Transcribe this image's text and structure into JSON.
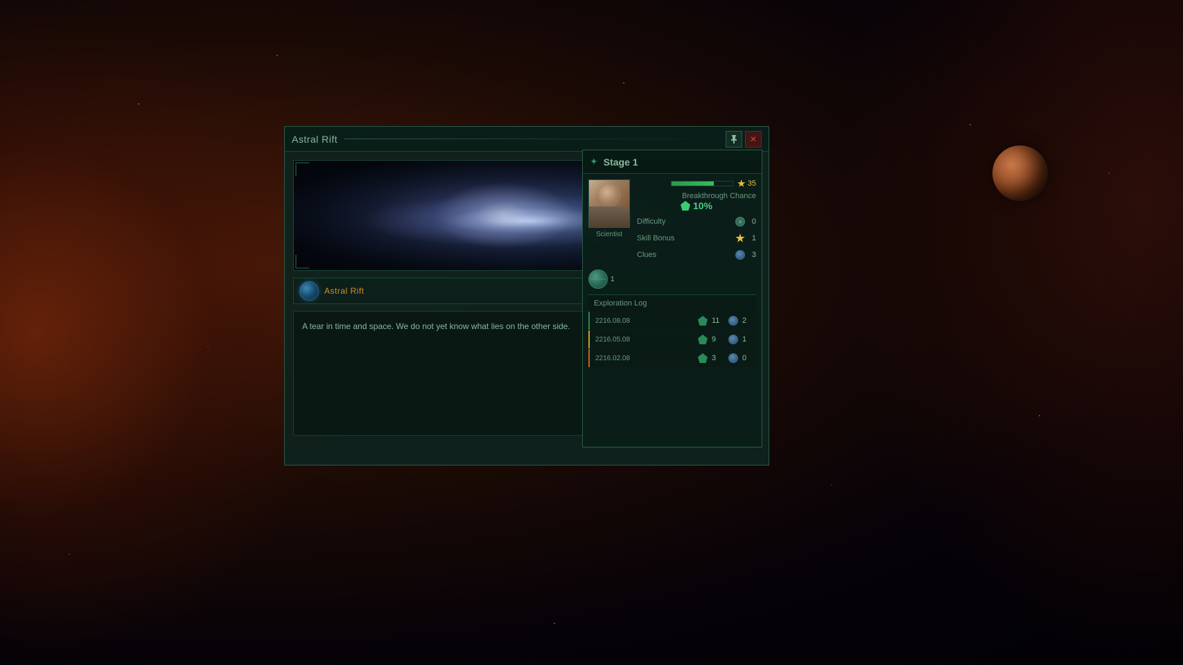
{
  "background": {
    "color": "#1a0a08"
  },
  "window": {
    "title": "Astral Rift",
    "subtitle": "Astral Rift",
    "description": "A tear in time and space. We do not yet know what lies on the other side.",
    "close_label": "✕",
    "pin_label": "⊕",
    "bar_title": "Astral Rift"
  },
  "stage": {
    "title": "Stage 1",
    "icon": "✦",
    "progress_value": "35",
    "breakthrough_label": "Breakthrough Chance",
    "breakthrough_value": "10%",
    "scientist_label": "Scientist",
    "stats": {
      "difficulty_label": "Difficulty",
      "difficulty_value": "0",
      "skill_label": "Skill Bonus",
      "skill_value": "1",
      "clues_label": "Clues",
      "clues_value": "3"
    },
    "globe_number": "1"
  },
  "exploration_log": {
    "header": "Exploration Log",
    "entries": [
      {
        "date": "2216.08.08",
        "gem_value": "11",
        "clue_value": "2",
        "accent": "green"
      },
      {
        "date": "2216.05.08",
        "gem_value": "9",
        "clue_value": "1",
        "accent": "yellow"
      },
      {
        "date": "2216.02.08",
        "gem_value": "3",
        "clue_value": "0",
        "accent": "orange"
      }
    ]
  }
}
